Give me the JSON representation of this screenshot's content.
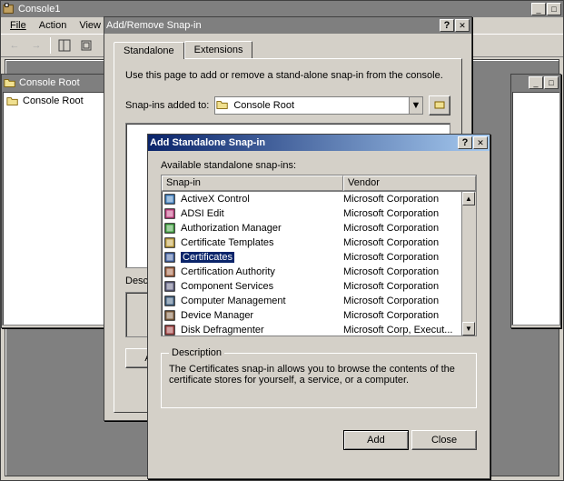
{
  "main_window": {
    "title": "Console1",
    "menus": {
      "file": "File",
      "action": "Action",
      "view": "View"
    }
  },
  "console_root_window": {
    "title": "Console Root",
    "tree_root": "Console Root"
  },
  "addremove_dialog": {
    "title": "Add/Remove Snap-in",
    "tabs": {
      "standalone": "Standalone",
      "extensions": "Extensions"
    },
    "instruction": "Use this page to add or remove a stand-alone snap-in from the console.",
    "added_label": "Snap-ins added to:",
    "combo_value": "Console Root",
    "desc_label": "Description"
  },
  "addstandalone_dialog": {
    "title": "Add Standalone Snap-in",
    "available_label": "Available standalone snap-ins:",
    "col_snapin": "Snap-in",
    "col_vendor": "Vendor",
    "snapins": [
      {
        "name": "ActiveX Control",
        "vendor": "Microsoft Corporation",
        "sel": false
      },
      {
        "name": "ADSI Edit",
        "vendor": "Microsoft Corporation",
        "sel": false
      },
      {
        "name": "Authorization Manager",
        "vendor": "Microsoft Corporation",
        "sel": false
      },
      {
        "name": "Certificate Templates",
        "vendor": "Microsoft Corporation",
        "sel": false
      },
      {
        "name": "Certificates",
        "vendor": "Microsoft Corporation",
        "sel": true
      },
      {
        "name": "Certification Authority",
        "vendor": "Microsoft Corporation",
        "sel": false
      },
      {
        "name": "Component Services",
        "vendor": "Microsoft Corporation",
        "sel": false
      },
      {
        "name": "Computer Management",
        "vendor": "Microsoft Corporation",
        "sel": false
      },
      {
        "name": "Device Manager",
        "vendor": "Microsoft Corporation",
        "sel": false
      },
      {
        "name": "Disk Defragmenter",
        "vendor": "Microsoft Corp, Execut...",
        "sel": false
      }
    ],
    "desc_group": "Description",
    "desc_text": "The Certificates snap-in allows you to browse the contents of the certificate stores for yourself, a service, or a computer.",
    "add_btn": "Add",
    "close_btn": "Close"
  }
}
